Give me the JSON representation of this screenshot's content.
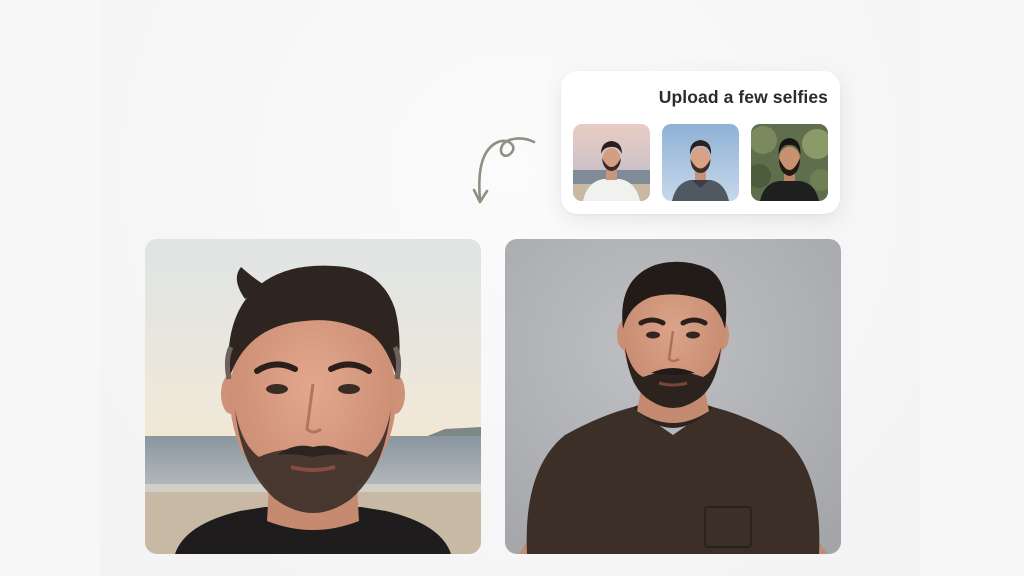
{
  "upload_card": {
    "title": "Upload a few selfies",
    "thumbnails": [
      {
        "icon": "beach-selfie-thumbnail"
      },
      {
        "icon": "sky-selfie-thumbnail"
      },
      {
        "icon": "garden-selfie-thumbnail"
      }
    ]
  },
  "arrow": {
    "icon": "curly-arrow-icon"
  },
  "photos": [
    {
      "icon": "beach-portrait-photo"
    },
    {
      "icon": "studio-headshot-photo"
    }
  ]
}
